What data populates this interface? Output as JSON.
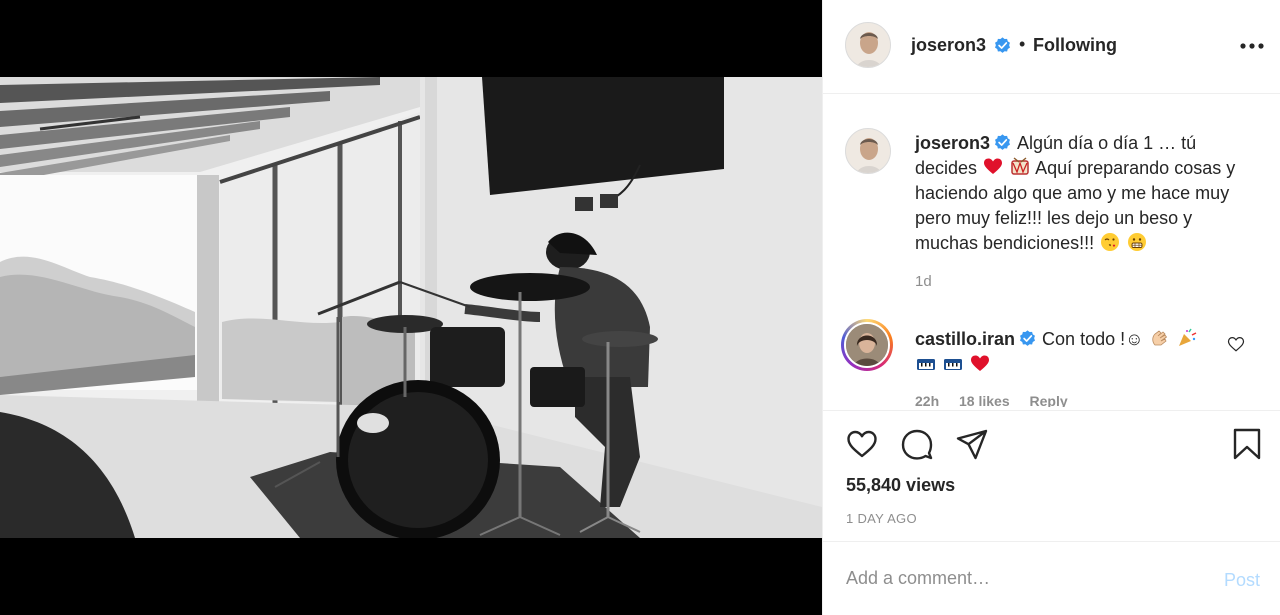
{
  "post": {
    "username": "joseron3",
    "dot": "•",
    "follow_status": "Following"
  },
  "caption": {
    "username": "joseron3",
    "text_1": "Algún día o día 1 … tú decides",
    "text_2": "Aquí preparando cosas y haciendo algo que amo y me hace muy pero muy feliz!!! les dejo un beso y muchas bendiciones!!!",
    "time": "1d"
  },
  "comment": {
    "username": "castillo.iran",
    "text": "Con todo !☺",
    "time": "22h",
    "likes": "18 likes",
    "reply": "Reply"
  },
  "stats": {
    "views": "55,840 views",
    "date": "1 DAY AGO"
  },
  "composer": {
    "placeholder": "Add a comment…",
    "post_label": "Post"
  },
  "colors": {
    "verified": "#3897f0",
    "post_disabled": "#b3dbff",
    "secondary_text": "#8e8e8e"
  },
  "icons": [
    "more-options-icon",
    "verified-badge-icon",
    "like-icon",
    "comment-icon",
    "share-icon",
    "save-icon",
    "comment-like-icon"
  ]
}
